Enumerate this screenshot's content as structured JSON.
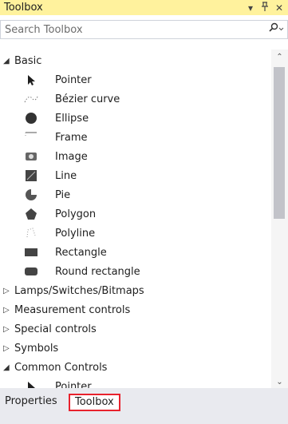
{
  "window": {
    "title": "Toolbox",
    "dropdown_icon": "▾",
    "pin_icon": "⌂",
    "close_icon": "✕"
  },
  "search": {
    "placeholder": "Search Toolbox"
  },
  "groups": {
    "basic": {
      "label": "Basic",
      "expanded": true
    },
    "lamps": {
      "label": "Lamps/Switches/Bitmaps",
      "expanded": false
    },
    "measurement": {
      "label": "Measurement controls",
      "expanded": false
    },
    "special": {
      "label": "Special controls",
      "expanded": false
    },
    "symbols": {
      "label": "Symbols",
      "expanded": false
    },
    "common": {
      "label": "Common Controls",
      "expanded": true
    }
  },
  "basic_items": [
    {
      "label": "Pointer",
      "icon": "pointer-icon"
    },
    {
      "label": "Bézier curve",
      "icon": "bezier-curve-icon"
    },
    {
      "label": "Ellipse",
      "icon": "ellipse-icon"
    },
    {
      "label": "Frame",
      "icon": "frame-icon"
    },
    {
      "label": "Image",
      "icon": "image-icon"
    },
    {
      "label": "Line",
      "icon": "line-icon"
    },
    {
      "label": "Pie",
      "icon": "pie-icon"
    },
    {
      "label": "Polygon",
      "icon": "polygon-icon"
    },
    {
      "label": "Polyline",
      "icon": "polyline-icon"
    },
    {
      "label": "Rectangle",
      "icon": "rectangle-icon"
    },
    {
      "label": "Round rectangle",
      "icon": "round-rectangle-icon"
    }
  ],
  "common_items": [
    {
      "label": "Pointer",
      "icon": "pointer-icon"
    }
  ],
  "tabs": [
    {
      "label": "Properties",
      "active": false
    },
    {
      "label": "Toolbox",
      "active": true
    }
  ],
  "colors": {
    "titlebar": "#fff29d",
    "active_tab_border": "#e8222d"
  }
}
